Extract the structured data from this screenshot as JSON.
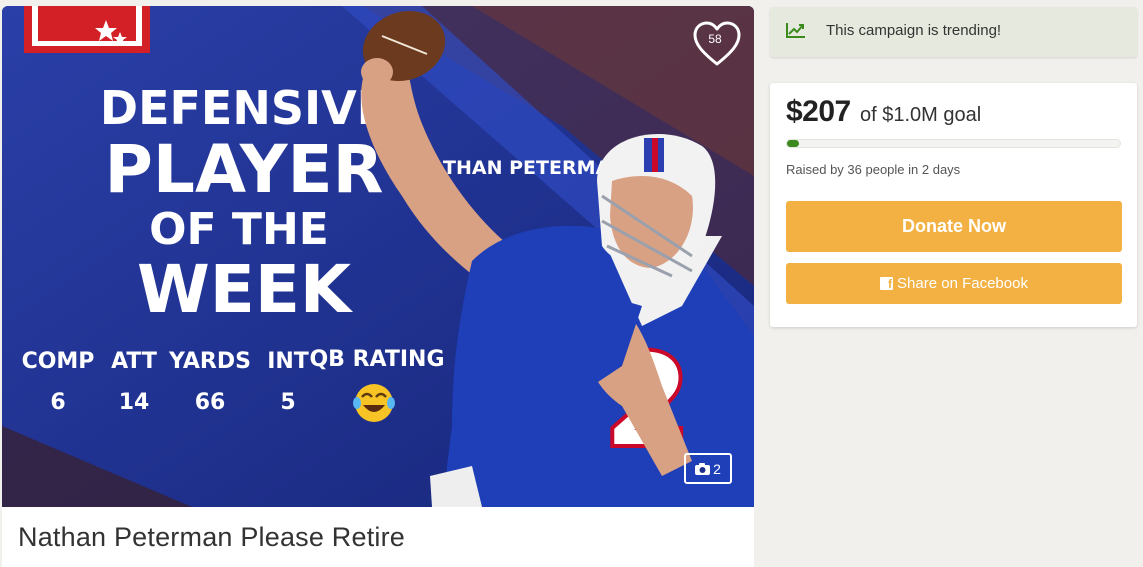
{
  "hero": {
    "afc_logo": "AFC shield logo",
    "headline": [
      "DEFENSIVE",
      "PLAYER",
      "OF THE",
      "WEEK"
    ],
    "player_name": "NATHAN PETERMAN",
    "jersey_number": "2",
    "stats": [
      {
        "label": "COMP",
        "value": "6"
      },
      {
        "label": "ATT",
        "value": "14"
      },
      {
        "label": "YARDS",
        "value": "66"
      },
      {
        "label": "INT",
        "value": "5"
      },
      {
        "label": "QB RATING",
        "value": "😂"
      }
    ],
    "heart_icon": "heart-outline-icon",
    "heart_count": "58",
    "photo_icon": "camera-icon",
    "photo_count": "2"
  },
  "campaign": {
    "title": "Nathan Peterman Please Retire"
  },
  "trending": {
    "icon": "trend-up-icon",
    "text": "This campaign is trending!"
  },
  "donation": {
    "raised": "$207",
    "goal_text": "of $1.0M goal",
    "progress_fraction": 0.03,
    "raised_by": "Raised by 36 people in 2 days",
    "donate_label": "Donate Now",
    "share_label": "Share on Facebook",
    "share_icon": "facebook-icon"
  },
  "colors": {
    "accent": "#f3b143",
    "progress": "#3c8a1d",
    "trend_bg": "#e6e9de",
    "trend_icon": "#3c8a1d",
    "hero_blue": "#1d2f8c"
  }
}
